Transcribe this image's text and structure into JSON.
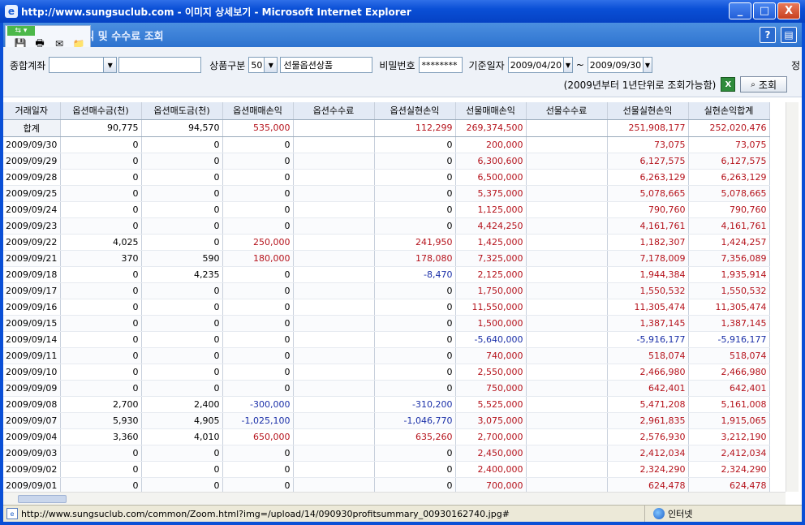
{
  "window": {
    "title": "http://www.sungsuclub.com - 이미지 상세보기 - Microsoft Internet Explorer",
    "minimize": "_",
    "maximize": "□",
    "close": "X"
  },
  "popup": {
    "title": "옵션 매매손익 및 수수료 조회",
    "help_icon": "?",
    "print_icon": "▤"
  },
  "form": {
    "account_label": "종합계좌",
    "account_value": "",
    "account_name": "",
    "product_label": "상품구분",
    "product_code": "50",
    "product_name": "선물옵션상품",
    "password_label": "비밀번호",
    "password_value": "********",
    "date_label": "기준일자",
    "date_from": "2009/04/20",
    "date_sep": "~",
    "date_to": "2009/09/30",
    "right_cut": "정",
    "note": "(2009년부터 1년단위로 조회가능함)",
    "excel_label": "X",
    "search_button": "조회"
  },
  "table": {
    "total_row": [
      "합계",
      "90,775",
      "94,570",
      "535,000",
      "",
      "112,299",
      "269,374,500",
      "",
      "251,908,177",
      "252,020,476"
    ],
    "columns": [
      "거래일자",
      "옵션매수금(천)",
      "옵션매도금(천)",
      "옵션매매손익",
      "옵션수수료",
      "옵션실현손익",
      "선물매매손익",
      "선물수수료",
      "선물실현손익",
      "실현손익합계"
    ],
    "rows": [
      [
        "2009/09/30",
        "0",
        "0",
        "0",
        "",
        "0",
        "200,000",
        "",
        "73,075",
        "73,075"
      ],
      [
        "2009/09/29",
        "0",
        "0",
        "0",
        "",
        "0",
        "6,300,600",
        "",
        "6,127,575",
        "6,127,575"
      ],
      [
        "2009/09/28",
        "0",
        "0",
        "0",
        "",
        "0",
        "6,500,000",
        "",
        "6,263,129",
        "6,263,129"
      ],
      [
        "2009/09/25",
        "0",
        "0",
        "0",
        "",
        "0",
        "5,375,000",
        "",
        "5,078,665",
        "5,078,665"
      ],
      [
        "2009/09/24",
        "0",
        "0",
        "0",
        "",
        "0",
        "1,125,000",
        "",
        "790,760",
        "790,760"
      ],
      [
        "2009/09/23",
        "0",
        "0",
        "0",
        "",
        "0",
        "4,424,250",
        "",
        "4,161,761",
        "4,161,761"
      ],
      [
        "2009/09/22",
        "4,025",
        "0",
        "250,000",
        "",
        "241,950",
        "1,425,000",
        "",
        "1,182,307",
        "1,424,257"
      ],
      [
        "2009/09/21",
        "370",
        "590",
        "180,000",
        "",
        "178,080",
        "7,325,000",
        "",
        "7,178,009",
        "7,356,089"
      ],
      [
        "2009/09/18",
        "0",
        "4,235",
        "0",
        "",
        "-8,470",
        "2,125,000",
        "",
        "1,944,384",
        "1,935,914"
      ],
      [
        "2009/09/17",
        "0",
        "0",
        "0",
        "",
        "0",
        "1,750,000",
        "",
        "1,550,532",
        "1,550,532"
      ],
      [
        "2009/09/16",
        "0",
        "0",
        "0",
        "",
        "0",
        "11,550,000",
        "",
        "11,305,474",
        "11,305,474"
      ],
      [
        "2009/09/15",
        "0",
        "0",
        "0",
        "",
        "0",
        "1,500,000",
        "",
        "1,387,145",
        "1,387,145"
      ],
      [
        "2009/09/14",
        "0",
        "0",
        "0",
        "",
        "0",
        "-5,640,000",
        "",
        "-5,916,177",
        "-5,916,177"
      ],
      [
        "2009/09/11",
        "0",
        "0",
        "0",
        "",
        "0",
        "740,000",
        "",
        "518,074",
        "518,074"
      ],
      [
        "2009/09/10",
        "0",
        "0",
        "0",
        "",
        "0",
        "2,550,000",
        "",
        "2,466,980",
        "2,466,980"
      ],
      [
        "2009/09/09",
        "0",
        "0",
        "0",
        "",
        "0",
        "750,000",
        "",
        "642,401",
        "642,401"
      ],
      [
        "2009/09/08",
        "2,700",
        "2,400",
        "-300,000",
        "",
        "-310,200",
        "5,525,000",
        "",
        "5,471,208",
        "5,161,008"
      ],
      [
        "2009/09/07",
        "5,930",
        "4,905",
        "-1,025,100",
        "",
        "-1,046,770",
        "3,075,000",
        "",
        "2,961,835",
        "1,915,065"
      ],
      [
        "2009/09/04",
        "3,360",
        "4,010",
        "650,000",
        "",
        "635,260",
        "2,700,000",
        "",
        "2,576,930",
        "3,212,190"
      ],
      [
        "2009/09/03",
        "0",
        "0",
        "0",
        "",
        "0",
        "2,450,000",
        "",
        "2,412,034",
        "2,412,034"
      ],
      [
        "2009/09/02",
        "0",
        "0",
        "0",
        "",
        "0",
        "2,400,000",
        "",
        "2,324,290",
        "2,324,290"
      ],
      [
        "2009/09/01",
        "0",
        "0",
        "0",
        "",
        "0",
        "700,000",
        "",
        "624,478",
        "624,478"
      ]
    ]
  },
  "status": {
    "url": "http://www.sungsuclub.com/common/Zoom.html?img=/upload/14/090930profitsummary_00930162740.jpg#",
    "zone": "인터넷"
  },
  "colors": {
    "positive": "#b5121b",
    "negative": "#1a2fa8",
    "header_bg": "#e3eaf5",
    "title_blue": "#0a4fd6"
  }
}
